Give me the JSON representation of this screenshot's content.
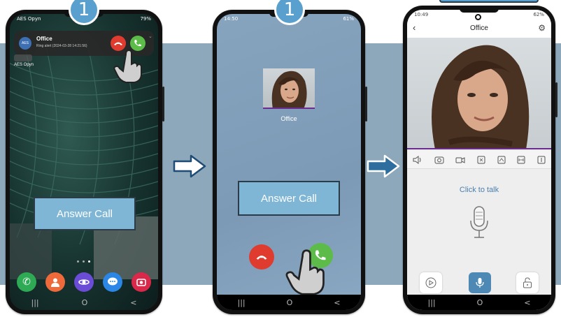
{
  "phone1": {
    "status_left": "AES Opyn",
    "status_right": "79%",
    "notification": {
      "app_label": "AES",
      "title": "Office",
      "subtitle": "Ring alert (2024-03-28 14:21:56)"
    },
    "homescreen_label": "AES Opyn",
    "answer_label": "Answer Call",
    "dock_icons": [
      "phone-icon",
      "contacts-icon",
      "internet-icon",
      "messages-icon",
      "camera-icon"
    ],
    "nav": [
      "|||",
      "O",
      "<"
    ]
  },
  "phone2": {
    "status_left": "14:50",
    "status_right": "61%",
    "caller_name": "Office",
    "answer_label": "Answer Call",
    "nav": [
      "|||",
      "O",
      "<"
    ]
  },
  "phone3": {
    "status_left": "10:49",
    "status_right": "62%",
    "header_title": "Office",
    "click_to_talk": "Click to talk",
    "toolbar_icons": [
      "speaker-icon",
      "snapshot-icon",
      "record-icon",
      "tool-icon-1",
      "tool-icon-2",
      "tool-icon-3",
      "tool-icon-4"
    ],
    "nav": [
      "|||",
      "O",
      "<"
    ]
  },
  "badges": [
    "1",
    "1"
  ],
  "colors": {
    "band": "#8da8ba",
    "badge": "#5aa0cf",
    "answer_bg": "#7fb6d6",
    "accept_green": "#5dbb4a",
    "reject_red": "#e03b2f",
    "arrow": "#2e6e9e",
    "purple_line": "#6b2c8f"
  }
}
